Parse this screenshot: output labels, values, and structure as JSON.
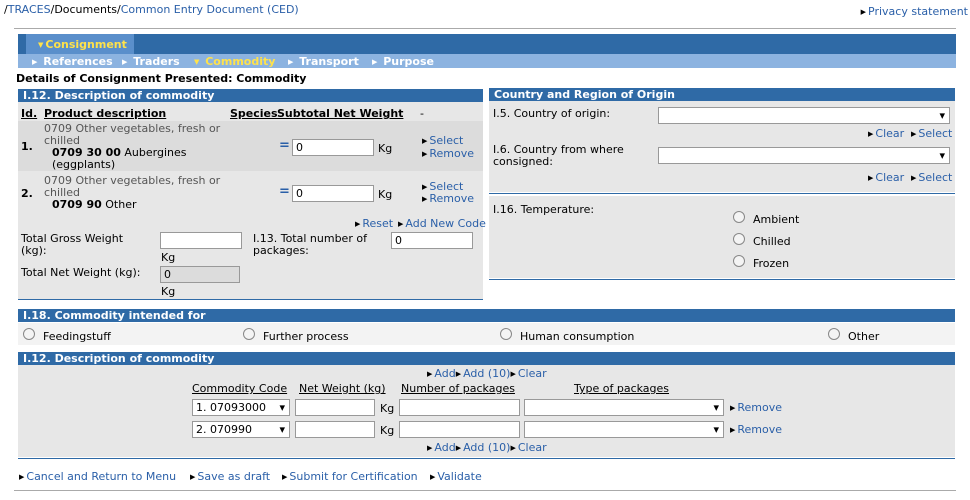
{
  "breadcrumb": {
    "sep": "/",
    "traces": "TRACES",
    "documents": "Documents",
    "ced": "Common Entry Document (CED)"
  },
  "privacy": "Privacy statement",
  "nav": {
    "top": "Consignment",
    "items": [
      "References",
      "Traders",
      "Commodity",
      "Transport",
      "Purpose"
    ]
  },
  "page_heading": "Details of Consignment Presented: Commodity",
  "desc_panel": {
    "title": "I.12. Description of commodity",
    "headers": {
      "id": "Id.",
      "product": "Product description",
      "species": "Species",
      "subtotal": "Subtotal Net Weight",
      "dash": "-"
    },
    "rows": [
      {
        "num": "1.",
        "line1": "0709 Other vegetables, fresh or chilled",
        "code": "0709 30 00",
        "line2": "Aubergines (eggplants)",
        "weight": "0",
        "unit": "Kg",
        "select": "Select",
        "remove": "Remove"
      },
      {
        "num": "2.",
        "line1": "0709 Other vegetables, fresh or chilled",
        "code": "0709 90",
        "line2": "Other",
        "weight": "0",
        "unit": "Kg",
        "select": "Select",
        "remove": "Remove"
      }
    ],
    "reset": "Reset",
    "add_new_code": "Add New Code",
    "gross_label": "Total Gross Weight (kg):",
    "gross_value": "",
    "gross_unit": "Kg",
    "packages_label": "I.13. Total number of packages:",
    "packages_value": "0",
    "net_label": "Total Net Weight (kg):",
    "net_value": "0",
    "net_unit": "Kg"
  },
  "origin_panel": {
    "title": "Country and Region of Origin",
    "country_label": "I.5. Country of origin:",
    "consigned_label": "I.6. Country from where consigned:",
    "clear": "Clear",
    "select": "Select"
  },
  "temperature": {
    "label": "I.16. Temperature:",
    "options": [
      "Ambient",
      "Chilled",
      "Frozen"
    ]
  },
  "intended": {
    "title": "I.18. Commodity intended for",
    "options": [
      "Feedingstuff",
      "Further process",
      "Human consumption",
      "Other"
    ]
  },
  "desc2": {
    "title": "I.12. Description of commodity",
    "add": "Add",
    "add10": "Add (10)",
    "clear": "Clear",
    "headers": {
      "code": "Commodity Code",
      "net": "Net Weight (kg)",
      "num": "Number of packages",
      "type": "Type of packages"
    },
    "rows": [
      {
        "code": "1. 07093000",
        "net": "",
        "unit": "Kg",
        "num": "",
        "type": "",
        "remove": "Remove"
      },
      {
        "code": "2. 070990",
        "net": "",
        "unit": "Kg",
        "num": "",
        "type": "",
        "remove": "Remove"
      }
    ]
  },
  "footer": [
    "Cancel and Return to Menu",
    "Save as draft",
    "Submit for Certification",
    "Validate"
  ]
}
